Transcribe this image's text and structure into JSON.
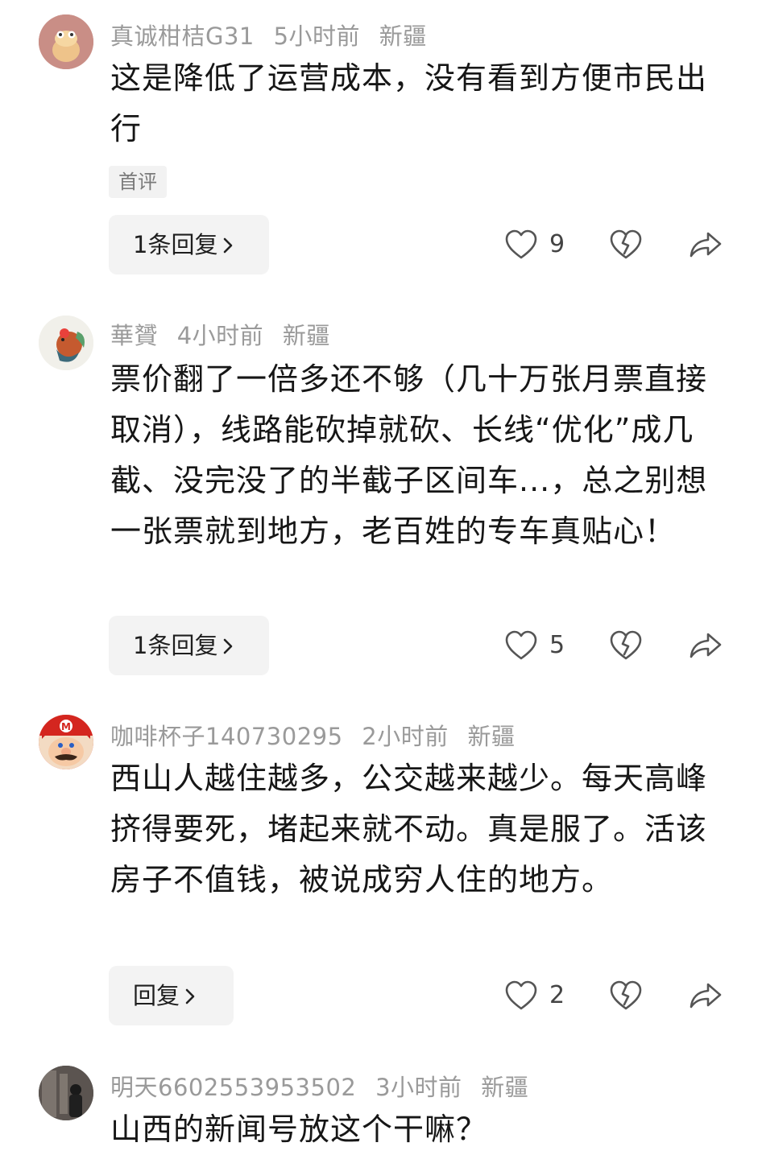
{
  "comments": [
    {
      "username": "真诚柑桔G31",
      "time": "5小时前",
      "location": "新疆",
      "text": "这是降低了运营成本，没有看到方便市民出行",
      "tag": "首评",
      "reply_label": "1条回复",
      "likes": "9"
    },
    {
      "username": "華贇",
      "time": "4小时前",
      "location": "新疆",
      "text": "票价翻了一倍多还不够（几十万张月票直接取消），线路能砍掉就砍、长线“优化”成几截、没完没了的半截子区间车...，总之别想一张票就到地方，老百姓的专车真贴心！",
      "reply_label": "1条回复",
      "likes": "5"
    },
    {
      "username": "咖啡杯子140730295",
      "time": "2小时前",
      "location": "新疆",
      "text": "西山人越住越多，公交越来越少。每天高峰挤得要死，堵起来就不动。真是服了。活该房子不值钱，被说成穷人住的地方。",
      "reply_label": "回复",
      "likes": "2"
    },
    {
      "username": "明天6602553953502",
      "time": "3小时前",
      "location": "新疆",
      "text": "山西的新闻号放这个干嘛？"
    }
  ],
  "icons": {
    "like": "heart-outline-icon",
    "dislike": "broken-heart-icon",
    "share": "share-arrow-icon",
    "chevron": "chevron-right-icon"
  }
}
